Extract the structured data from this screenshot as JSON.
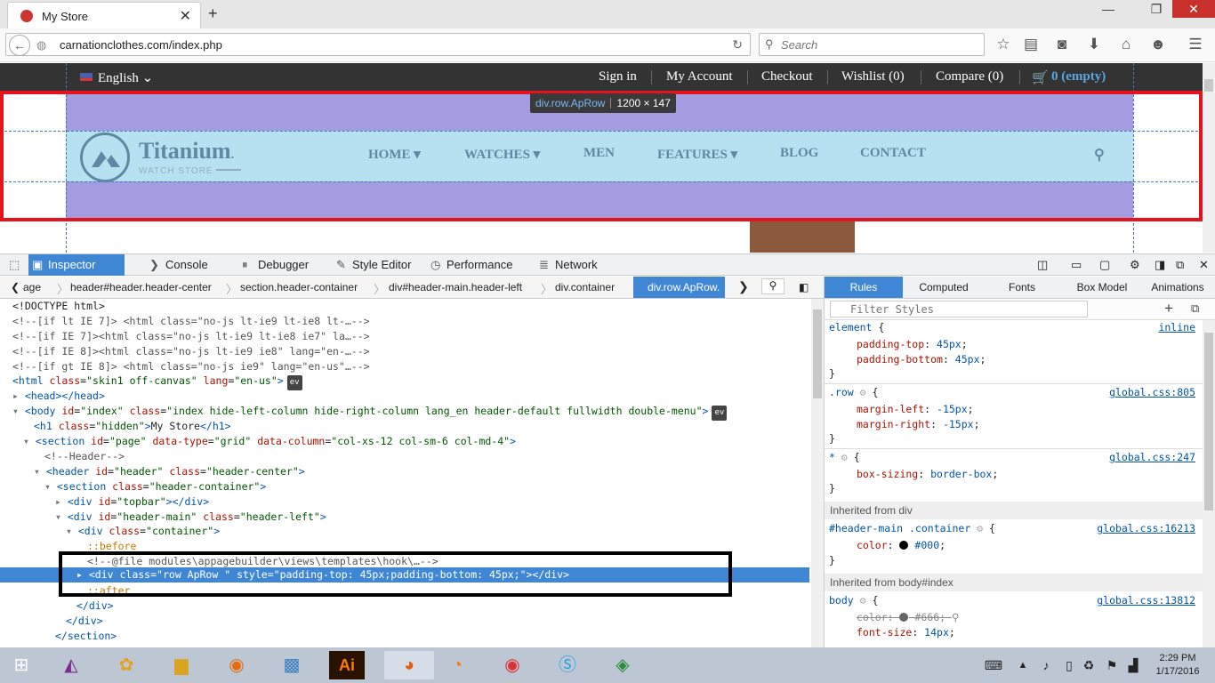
{
  "browser": {
    "tab_title": "My Store",
    "url": "carnationclothes.com/index.php",
    "search_placeholder": "Search"
  },
  "store": {
    "language": "English",
    "topbar_links": [
      "Sign in",
      "My Account",
      "Checkout",
      "Wishlist (0)",
      "Compare (0)"
    ],
    "cart": "0 (empty)",
    "brand": "Titanium",
    "brand_mark": ".",
    "tagline": "WATCH STORE",
    "menu": [
      "HOME",
      "WATCHES",
      "MEN",
      "FEATURES",
      "BLOG",
      "CONTACT"
    ]
  },
  "highlight_tooltip": {
    "selector": "div.row.ApRow",
    "size": "1200 × 147"
  },
  "devtools": {
    "tabs": [
      "Inspector",
      "Console",
      "Debugger",
      "Style Editor",
      "Performance",
      "Network"
    ],
    "breadcrumbs": [
      "age",
      "header#header.header-center",
      "section.header-container",
      "div#header-main.header-left",
      "div.container",
      "div.row.ApRow."
    ],
    "markup": {
      "doctype": "<!DOCTYPE html>",
      "c1": "<!--[if lt IE 7]> <html class=\"no-js lt-ie9 lt-ie8 lt-…-->",
      "c2": "<!--[if IE 7]><html class=\"no-js lt-ie9 lt-ie8 ie7\" la…-->",
      "c3": "<!--[if IE 8]><html class=\"no-js lt-ie9 ie8\" lang=\"en-…-->",
      "c4": "<!--[if gt IE 8]> <html class=\"no-js ie9\" lang=\"en-us\"…-->",
      "html_attr": "class",
      "html_val": "\"skin1 off-canvas\"",
      "html_lang_attr": "lang",
      "html_lang_val": "\"en-us\"",
      "head": "<head></head>",
      "body_id_val": "\"index\"",
      "body_class_val": "\"index hide-left-column hide-right-column lang_en header-default fullwidth double-menu\"",
      "h1_class_val": "\"hidden\"",
      "h1_text": "My Store",
      "section_id_val": "\"page\"",
      "section_type_val": "\"grid\"",
      "section_col_val": "\"col-xs-12 col-sm-6 col-md-4\"",
      "header_comment": "<!--Header-->",
      "header_id_val": "\"header\"",
      "header_class_val": "\"header-center\"",
      "hc_class_val": "\"header-container\"",
      "topbar_id_val": "\"topbar\"",
      "hm_id_val": "\"header-main\"",
      "hm_class_val": "\"header-left\"",
      "container_class_val": "\"container\"",
      "before": "::before",
      "file_comment": "<!--@file modules\\appagebuilder\\views\\templates\\hook\\…-->",
      "row_class_val": "\"row ApRow \"",
      "row_style_val": "\"padding-top: 45px;padding-bottom: 45px;\"",
      "after": "::after",
      "close_div": "</div>",
      "close_section": "</section>"
    },
    "rules_tabs": [
      "Rules",
      "Computed",
      "Fonts",
      "Box Model",
      "Animations"
    ],
    "filter_placeholder": "Filter Styles",
    "inherited_div": "Inherited from div",
    "inherited_body": "Inherited from body#index",
    "rules": {
      "r1_sel": "element",
      "r1_src": "inline",
      "r1_p1": "padding-top",
      "r1_v1": "45px",
      "r1_p2": "padding-bottom",
      "r1_v2": "45px",
      "r2_sel": ".row",
      "r2_src": "global.css:805",
      "r2_p1": "margin-left",
      "r2_v1": "-15px",
      "r2_p2": "margin-right",
      "r2_v2": "-15px",
      "r3_sel": "*",
      "r3_src": "global.css:247",
      "r3_p1": "box-sizing",
      "r3_v1": "border-box",
      "r4_sel": "#header-main .container",
      "r4_src": "global.css:16213",
      "r4_p1": "color",
      "r4_v1": "#000",
      "r5_sel": "body",
      "r5_src": "global.css:13812",
      "r5_p1": "color",
      "r5_v1": "#666",
      "r5_p2": "font-size",
      "r5_v2": "14px"
    }
  },
  "taskbar": {
    "time": "2:29 PM",
    "date": "1/17/2016"
  }
}
